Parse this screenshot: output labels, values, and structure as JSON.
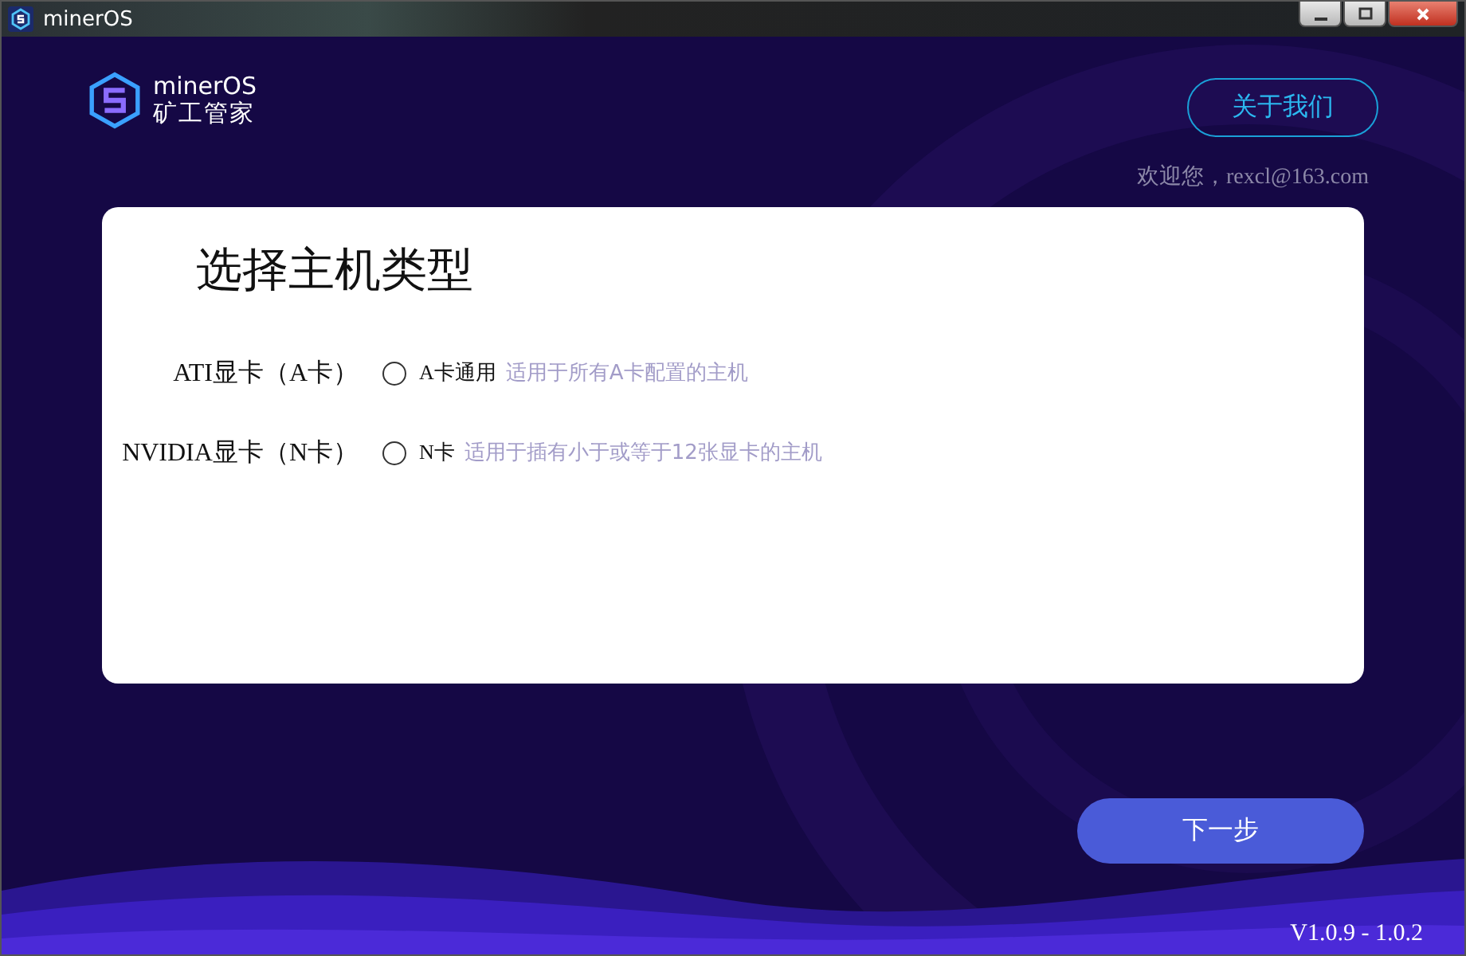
{
  "window": {
    "title": "minerOS"
  },
  "logo": {
    "name": "minerOS",
    "subtitle": "矿工管家"
  },
  "about_button": "关于我们",
  "welcome": "欢迎您，rexcl@163.com",
  "card": {
    "title": "选择主机类型",
    "options": [
      {
        "label": "ATI显卡（A卡）",
        "selected": false,
        "name": "A卡通用",
        "description": "适用于所有A卡配置的主机"
      },
      {
        "label": "NVIDIA显卡（N卡）",
        "selected": false,
        "name": "N卡",
        "description": "适用于插有小于或等于12张显卡的主机"
      }
    ]
  },
  "next_button": "下一步",
  "version": "V1.0.9 - 1.0.2"
}
